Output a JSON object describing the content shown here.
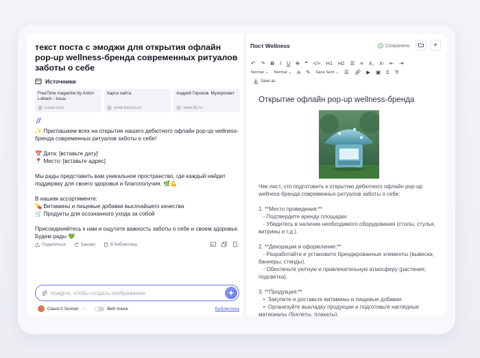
{
  "left": {
    "post_title": "текст поста с эмоджи для открытия  офлайн pop-up wellness-бренда современных ритуалов заботы о себе",
    "sources_heading": "Источники",
    "sources": [
      {
        "title": "FreeTime magazine by Anton Lobach - Issuu",
        "url": "issue.com"
      },
      {
        "title": "Карта сайта",
        "url": "www.beicon.ru"
      },
      {
        "title": "Андрей Горохов. Музпросвет",
        "url": "www.lib.ru"
      }
    ],
    "marker": "//",
    "paragraphs": [
      "✨ Приглашаем всех на открытие нашего дебютного офлайн pop-up wellness-бренда современных ритуалов заботы о себе!",
      "📅 Дата: [вставьте дату]\n📍 Место: [вставьте адрес]",
      "Мы рады представить вам уникальное пространство, где каждый найдет поддержку для своего здоровья и благополучия. 🌿💪",
      "В нашем ассортименте:\n💊 Витамины и пищевые добавки высочайшего качества\n🛒 Продукты для осознанного ухода за собой",
      "Присоединяйтесь к нам и ощутите важность заботы о себе и своем здоровье. Будем рады 💚"
    ],
    "actions": {
      "share": "Поделиться",
      "again": "Заново",
      "library": "В библиотеку"
    },
    "prompt_placeholder": "Imagine, чтобы создать изображение",
    "model": "Claud-3 Sonnet",
    "web_search": "Веб поиск",
    "library_link": "Библиотека"
  },
  "right": {
    "header": "Пост Wellness",
    "saved": "Сохранено",
    "toolbar": {
      "h1": "H1",
      "h2": "H2",
      "normal1": "Normal",
      "normal2": "Normal",
      "font": "Sans Serif",
      "save_as": "Save as"
    },
    "doc_title": "Открытие  офлайн pop-up wellness-бренда",
    "doc_paragraphs": [
      "Чек-лист, что подготовить к открытию дебютного офлайн pop-up wellness-бренда современных ритуалов заботы о себе:",
      "1. **Место проведения:**\n   - Подтвердите аренду площадки.\n   - Убедитесь в наличии необходимого оборудования (столы, стулья, витрины и т.д.).",
      "2. **Декорации и оформление:**\n   - Разработайте и установите брендированные элементы (вывески, баннеры, стенды).\n   - Обеспечьте уютную и привлекательную атмосферу (растения, подсветка).",
      "3. **Продукция:**\n   •  Закупите и доставьте витамины и пищевые добавки.\n   •  Организуйте выкладку продукции и подготовьте наглядные материалы (буклеты, плакаты)."
    ]
  }
}
